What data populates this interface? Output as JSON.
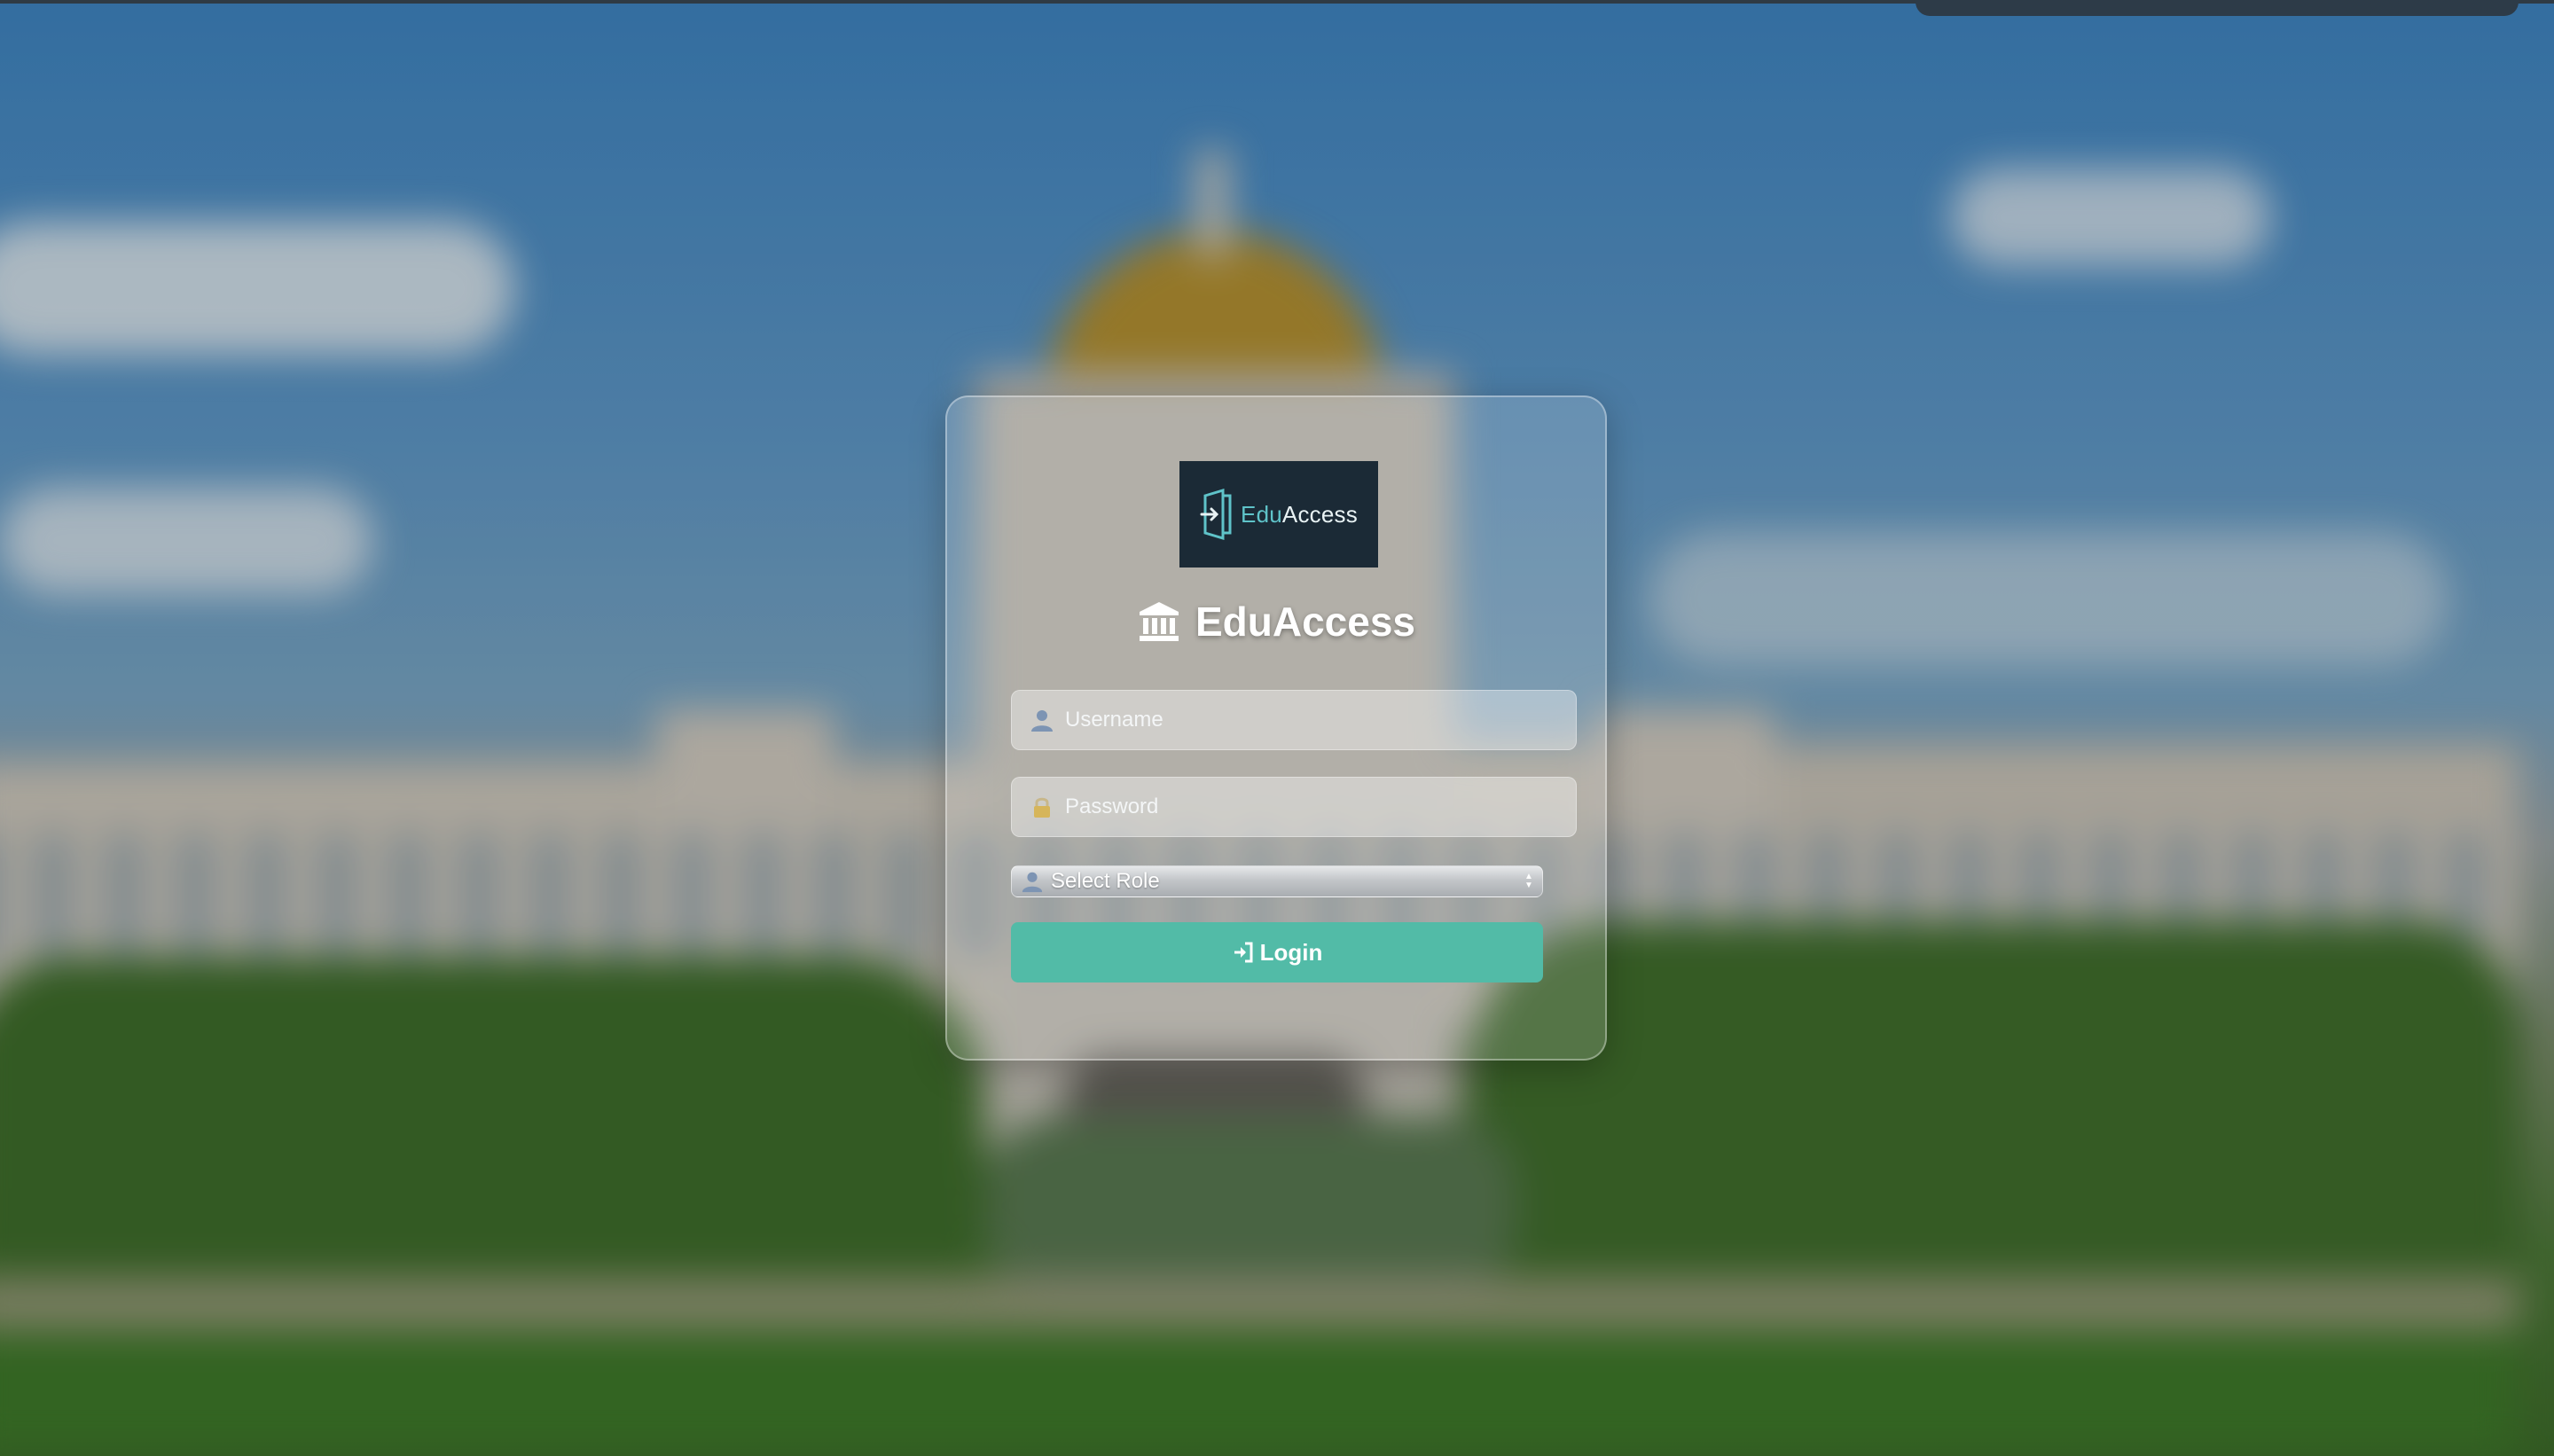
{
  "logo": {
    "text_prefix": "Edu",
    "text_suffix": "Access"
  },
  "header": {
    "title": "EduAccess"
  },
  "form": {
    "username_placeholder": "Username",
    "password_placeholder": "Password",
    "role_selected": "Select Role",
    "login_label": "Login"
  },
  "colors": {
    "accent": "#52bba7",
    "logo_bg": "#1b2a36",
    "logo_accent": "#5fc3c9"
  },
  "icons": {
    "title": "institution-icon",
    "username": "user-icon",
    "password": "lock-icon",
    "role": "user-icon",
    "login": "sign-in-icon"
  }
}
